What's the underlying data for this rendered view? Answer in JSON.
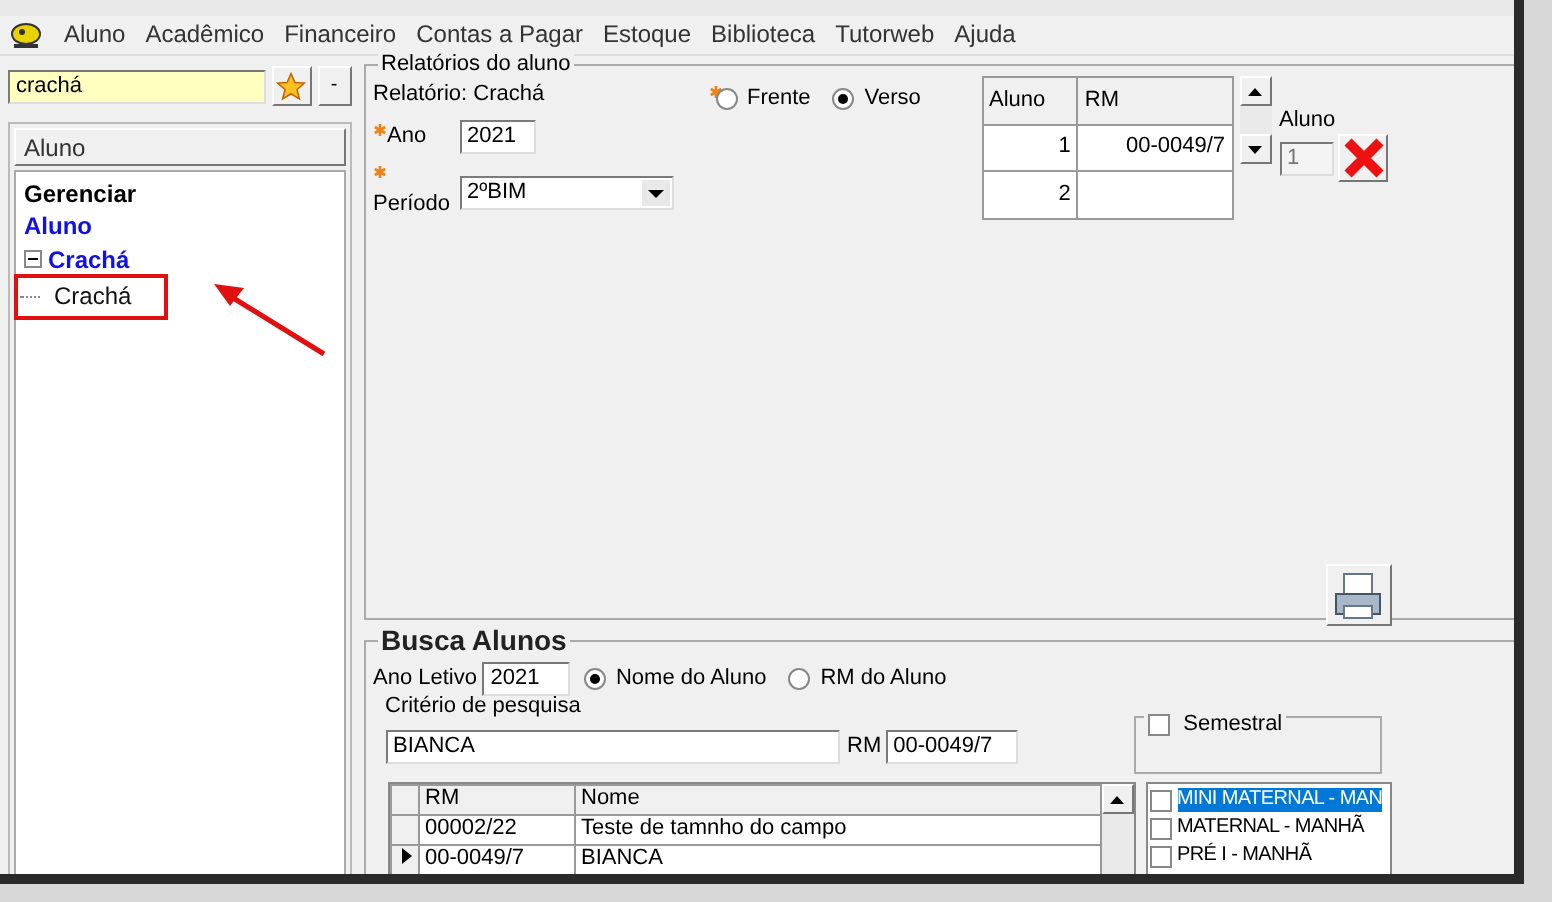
{
  "menu": [
    {
      "label": "Aluno"
    },
    {
      "label": "Acadêmico"
    },
    {
      "label": "Financeiro"
    },
    {
      "label": "Contas a Pagar"
    },
    {
      "label": "Estoque"
    },
    {
      "label": "Biblioteca"
    },
    {
      "label": "Tutorweb"
    },
    {
      "label": "Ajuda"
    }
  ],
  "search": {
    "value": "crachá"
  },
  "minus_button": {
    "label": "-"
  },
  "left_panel": {
    "header": "Aluno",
    "tree": [
      {
        "label": "Gerenciar",
        "kind": "group"
      },
      {
        "label": "Aluno",
        "kind": "module"
      },
      {
        "label": "Crachá",
        "kind": "module",
        "expanded": true,
        "children": [
          {
            "label": "Crachá",
            "kind": "report",
            "highlighted": true
          }
        ]
      }
    ]
  },
  "relatorios": {
    "title": "Relatórios do aluno",
    "subtitle": "Relatório: Crachá",
    "ano": {
      "label": "Ano",
      "required": true,
      "value": "2021"
    },
    "periodo": {
      "label": "Período",
      "required": true,
      "value": "2ºBIM"
    },
    "side_required": true,
    "side_options": [
      {
        "label": "Frente",
        "selected": false
      },
      {
        "label": "Verso",
        "selected": true
      }
    ],
    "grid": {
      "columns": [
        "Aluno",
        "RM"
      ],
      "rows": [
        [
          "1",
          "00-0049/7"
        ],
        [
          "2"
        ]
      ]
    },
    "aluno_field": {
      "label": "Aluno",
      "value": "1",
      "disabled": true
    }
  },
  "busca": {
    "title": "Busca Alunos",
    "ano_letivo": {
      "label": "Ano Letivo",
      "value": "2021"
    },
    "search_by": [
      {
        "label": "Nome do Aluno",
        "selected": true
      },
      {
        "label": "RM do Aluno",
        "selected": false
      }
    ],
    "criterio": {
      "label": "Critério de pesquisa",
      "value": "BIANCA"
    },
    "rm": {
      "label": "RM",
      "value": "00-0049/7"
    },
    "semestral": {
      "label": "Semestral",
      "checked": false
    },
    "results": {
      "columns": [
        "RM",
        "Nome"
      ],
      "rows": [
        {
          "rm": "00002/22",
          "nome": "Teste de tamnho do campo",
          "current": false
        },
        {
          "rm": "00-0049/7",
          "nome": "BIANCA",
          "current": true
        }
      ]
    },
    "turmas": [
      {
        "label": "MINI MATERNAL - MAN",
        "checked": false,
        "selected": true
      },
      {
        "label": "MATERNAL - MANHÃ",
        "checked": false,
        "selected": false
      },
      {
        "label": "PRÉ I - MANHÃ",
        "checked": false,
        "selected": false
      }
    ]
  }
}
